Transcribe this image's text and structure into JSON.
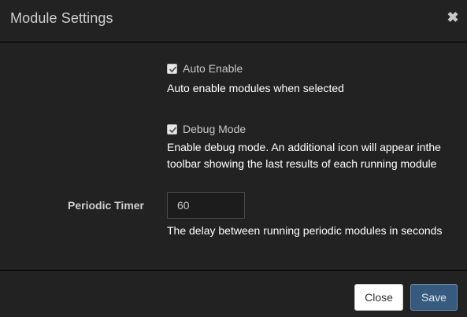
{
  "header": {
    "title": "Module Settings",
    "close_glyph": "✖",
    "close_icon": "close-icon"
  },
  "settings": {
    "auto_enable": {
      "label": "Auto Enable",
      "checked": true,
      "help": "Auto enable modules when selected"
    },
    "debug_mode": {
      "label": "Debug Mode",
      "checked": true,
      "help_line1": "Enable debug mode. An additional icon will appear inthe",
      "help_line2": "toolbar showing the last results of each running module"
    },
    "periodic_timer": {
      "label": "Periodic Timer",
      "value": "60",
      "help": "The delay between running periodic modules in seconds"
    }
  },
  "footer": {
    "close_label": "Close",
    "save_label": "Save"
  },
  "colors": {
    "background": "#222222",
    "primary": "#375a7f",
    "divider": "#000000"
  }
}
